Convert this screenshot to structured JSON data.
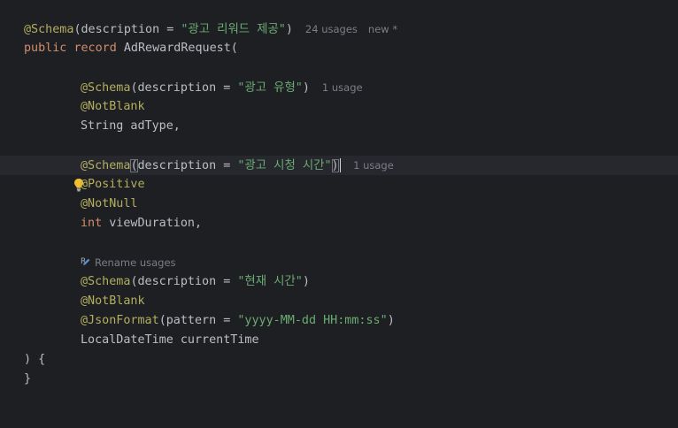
{
  "code": {
    "l1": {
      "annotation": "@Schema",
      "open": "(description = ",
      "string": "\"광고 리워드 제공\"",
      "close": ")",
      "usages": "24 usages",
      "status": "new *"
    },
    "l2": {
      "kw1": "public",
      "kw2": "record",
      "rest": "AdRewardRequest("
    },
    "f1": {
      "annotation": "@Schema",
      "open": "(description = ",
      "string": "\"광고 유형\"",
      "close": ")",
      "usages": "1 usage",
      "not_blank": "@NotBlank",
      "declaration": "String adType,"
    },
    "f2": {
      "annotation": "@Schema",
      "paren_open": "(",
      "open": "description = ",
      "string": "\"광고 시청 시간\"",
      "close": ")",
      "usages": "1 usage",
      "positive": "@Positive",
      "not_null": "@NotNull",
      "type_kw": "int",
      "declaration": "viewDuration,"
    },
    "f3": {
      "rename_hint": "Rename usages",
      "rename_icon_letter": "R",
      "annotation": "@Schema",
      "open": "(description = ",
      "string": "\"현재 시간\"",
      "close": ")",
      "not_blank": "@NotBlank",
      "json_format": "@JsonFormat",
      "jf_open": "(pattern = ",
      "jf_string": "\"yyyy-MM-dd HH:mm:ss\"",
      "jf_close": ")",
      "declaration": "LocalDateTime currentTime"
    },
    "close_record": ") {",
    "close_brace": "}"
  },
  "icons": {
    "gutter": "lightbulb-icon",
    "rename": "rename-pencil-icon"
  },
  "colors": {
    "background": "#1e1f22",
    "current_line": "#26282e",
    "annotation": "#b3ae60",
    "keyword": "#cf8e6d",
    "string": "#6aab73",
    "text": "#bcbec4",
    "hint": "#7a7e85",
    "bulb": "#f0c030"
  }
}
